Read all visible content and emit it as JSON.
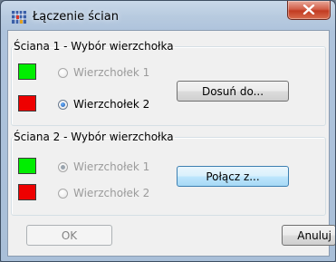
{
  "window": {
    "title": "Łączenie ścian",
    "close_glyph": "X"
  },
  "wall1": {
    "legend": "Ściana 1 - Wybór wierzchołka",
    "vertex1": {
      "label": "Wierzchołek 1",
      "swatch_color": "#00ee00",
      "checked": false,
      "enabled": false
    },
    "vertex2": {
      "label": "Wierzchołek 2",
      "swatch_color": "#ee0000",
      "checked": true,
      "enabled": true
    },
    "action_label": "Dosuń do..."
  },
  "wall2": {
    "legend": "Ściana 2 - Wybór wierzchołka",
    "vertex1": {
      "label": "Wierzchołek 1",
      "swatch_color": "#00ee00",
      "checked": true,
      "enabled": false
    },
    "vertex2": {
      "label": "Wierzchołek 2",
      "swatch_color": "#ee0000",
      "checked": false,
      "enabled": false
    },
    "action_label": "Połącz z..."
  },
  "buttons": {
    "ok_label": "OK",
    "cancel_label": "Anuluj"
  },
  "icons": {
    "app": "grid-app-icon",
    "close": "close-icon"
  }
}
